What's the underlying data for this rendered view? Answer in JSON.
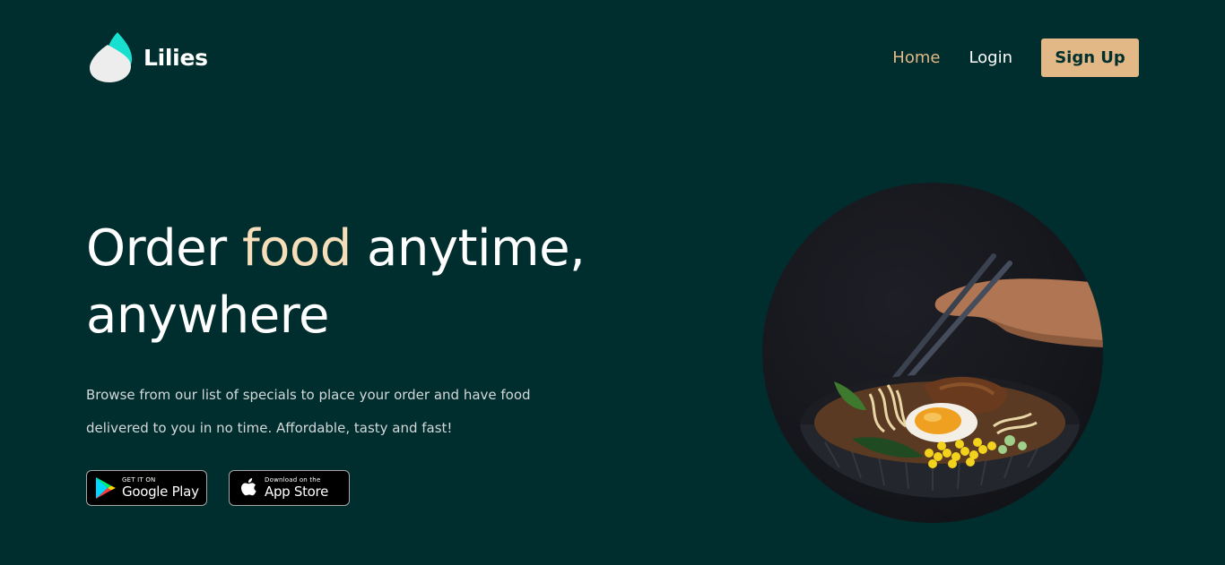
{
  "brand": {
    "name": "Lilies",
    "accent_color": "#e2b887",
    "background_color": "#002e2e",
    "logo_colors": [
      "#18e0d0",
      "#f2f2f2"
    ]
  },
  "nav": {
    "home_label": "Home",
    "login_label": "Login",
    "signup_label": "Sign Up"
  },
  "hero": {
    "title_part1": "Order ",
    "title_accent": "food",
    "title_part2": " anytime,",
    "title_line2": "anywhere",
    "description": "Browse from our list of specials to place your order and have food delivered to you in no time. Affordable, tasty and fast!"
  },
  "stores": {
    "google": {
      "small": "GET IT ON",
      "big": "Google Play",
      "icon": "google-play-icon"
    },
    "apple": {
      "small": "Download on the",
      "big": "App Store",
      "icon": "apple-icon"
    }
  },
  "image": {
    "subject": "ramen-bowl-with-chopsticks"
  }
}
